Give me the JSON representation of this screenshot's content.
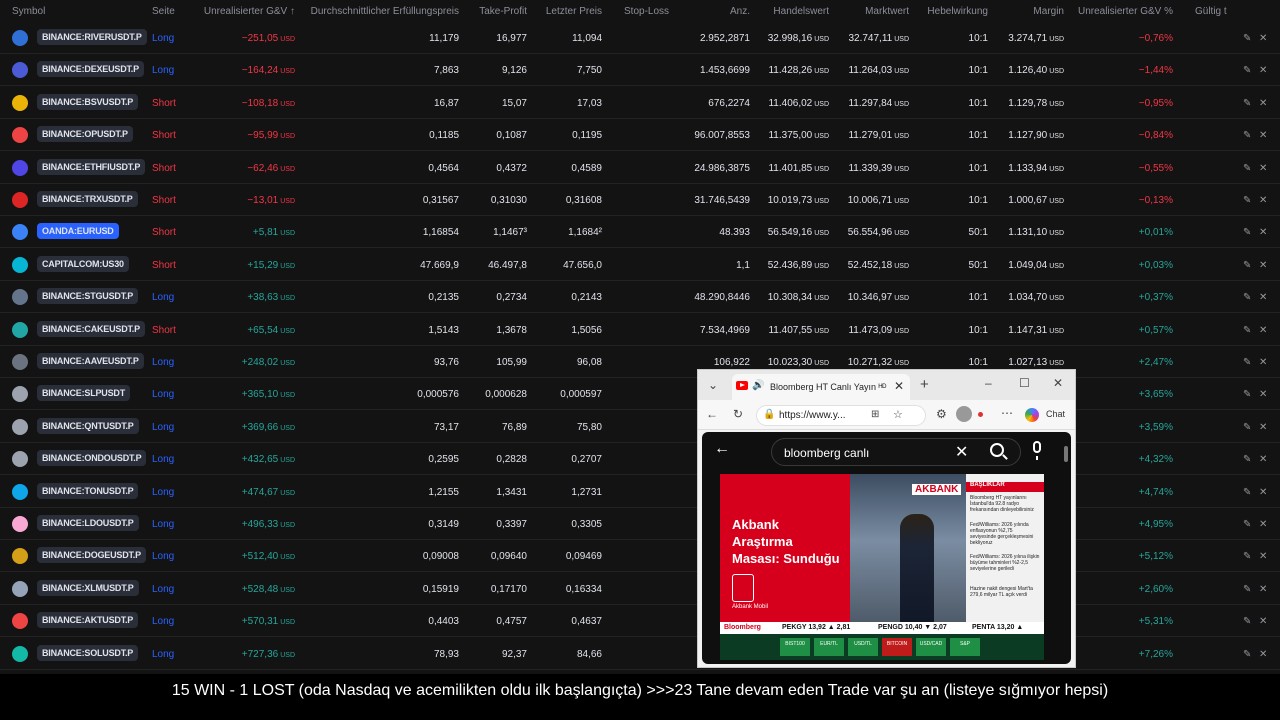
{
  "headers": {
    "symbol": "Symbol",
    "side": "Seite",
    "unrealized": "Unrealisierter G&V ↑",
    "avg_fill": "Durchschnittlicher Erfüllungspreis",
    "take_profit": "Take-Profit",
    "last_price": "Letzter Preis",
    "stop_loss": "Stop-Loss",
    "qty": "Anz.",
    "trade_value": "Handelswert",
    "market_value": "Marktwert",
    "leverage": "Hebelwirkung",
    "margin": "Margin",
    "unrealized_pct": "Unrealisierter G&V %",
    "valid": "Gültig t"
  },
  "currency": "USD",
  "rows": [
    {
      "symbol": "BINANCE:RIVERUSDT.P",
      "side": "Long",
      "pnl": "−251,05",
      "avg": "11,179",
      "tp": "16,977",
      "last": "11,094",
      "qty": "2.952,2871",
      "tv": "32.998,16",
      "mv": "32.747,11",
      "lev": "10:1",
      "margin": "3.274,71",
      "pct": "−0,76%"
    },
    {
      "symbol": "BINANCE:DEXEUSDT.P",
      "side": "Long",
      "pnl": "−164,24",
      "avg": "7,863",
      "tp": "9,126",
      "last": "7,750",
      "qty": "1.453,6699",
      "tv": "11.428,26",
      "mv": "11.264,03",
      "lev": "10:1",
      "margin": "1.126,40",
      "pct": "−1,44%"
    },
    {
      "symbol": "BINANCE:BSVUSDT.P",
      "side": "Short",
      "pnl": "−108,18",
      "avg": "16,87",
      "tp": "15,07",
      "last": "17,03",
      "qty": "676,2274",
      "tv": "11.406,02",
      "mv": "11.297,84",
      "lev": "10:1",
      "margin": "1.129,78",
      "pct": "−0,95%"
    },
    {
      "symbol": "BINANCE:OPUSDT.P",
      "side": "Short",
      "pnl": "−95,99",
      "avg": "0,1185",
      "tp": "0,1087",
      "last": "0,1195",
      "qty": "96.007,8553",
      "tv": "11.375,00",
      "mv": "11.279,01",
      "lev": "10:1",
      "margin": "1.127,90",
      "pct": "−0,84%"
    },
    {
      "symbol": "BINANCE:ETHFIUSDT.P",
      "side": "Short",
      "pnl": "−62,46",
      "avg": "0,4564",
      "tp": "0,4372",
      "last": "0,4589",
      "qty": "24.986,3875",
      "tv": "11.401,85",
      "mv": "11.339,39",
      "lev": "10:1",
      "margin": "1.133,94",
      "pct": "−0,55%"
    },
    {
      "symbol": "BINANCE:TRXUSDT.P",
      "side": "Short",
      "pnl": "−13,01",
      "avg": "0,31567",
      "tp": "0,31030",
      "last": "0,31608",
      "qty": "31.746,5439",
      "tv": "10.019,73",
      "mv": "10.006,71",
      "lev": "10:1",
      "margin": "1.000,67",
      "pct": "−0,13%"
    },
    {
      "symbol": "OANDA:EURUSD",
      "side": "Short",
      "pnl": "+5,81",
      "avg": "1,16854",
      "tp": "1,1467³",
      "last": "1,1684²",
      "qty": "48.393",
      "tv": "56.549,16",
      "mv": "56.554,96",
      "lev": "50:1",
      "margin": "1.131,10",
      "pct": "+0,01%"
    },
    {
      "symbol": "CAPITALCOM:US30",
      "side": "Short",
      "pnl": "+15,29",
      "avg": "47.669,9",
      "tp": "46.497,8",
      "last": "47.656,0",
      "qty": "1,1",
      "tv": "52.436,89",
      "mv": "52.452,18",
      "lev": "50:1",
      "margin": "1.049,04",
      "pct": "+0,03%"
    },
    {
      "symbol": "BINANCE:STGUSDT.P",
      "side": "Long",
      "pnl": "+38,63",
      "avg": "0,2135",
      "tp": "0,2734",
      "last": "0,2143",
      "qty": "48.290,8446",
      "tv": "10.308,34",
      "mv": "10.346,97",
      "lev": "10:1",
      "margin": "1.034,70",
      "pct": "+0,37%"
    },
    {
      "symbol": "BINANCE:CAKEUSDT.P",
      "side": "Short",
      "pnl": "+65,54",
      "avg": "1,5143",
      "tp": "1,3678",
      "last": "1,5056",
      "qty": "7.534,4969",
      "tv": "11.407,55",
      "mv": "11.473,09",
      "lev": "10:1",
      "margin": "1.147,31",
      "pct": "+0,57%"
    },
    {
      "symbol": "BINANCE:AAVEUSDT.P",
      "side": "Long",
      "pnl": "+248,02",
      "avg": "93,76",
      "tp": "105,99",
      "last": "96,08",
      "qty": "106,922",
      "tv": "10.023,30",
      "mv": "10.271,32",
      "lev": "10:1",
      "margin": "1.027,13",
      "pct": "+2,47%"
    },
    {
      "symbol": "BINANCE:SLPUSDT",
      "side": "Long",
      "pnl": "+365,10",
      "avg": "0,000576",
      "tp": "0,000628",
      "last": "0,000597",
      "qty": "17.",
      "tv": "",
      "mv": "",
      "lev": "",
      "margin": "",
      "pct": "+3,65%"
    },
    {
      "symbol": "BINANCE:QNTUSDT.P",
      "side": "Long",
      "pnl": "+369,66",
      "avg": "73,17",
      "tp": "76,89",
      "last": "75,80",
      "qty": "",
      "tv": "",
      "mv": "",
      "lev": "",
      "margin": "",
      "pct": "+3,59%"
    },
    {
      "symbol": "BINANCE:ONDOUSDT.P",
      "side": "Long",
      "pnl": "+432,65",
      "avg": "0,2595",
      "tp": "0,2828",
      "last": "0,2707",
      "qty": "",
      "tv": "",
      "mv": "",
      "lev": "",
      "margin": "",
      "pct": "+4,32%"
    },
    {
      "symbol": "BINANCE:TONUSDT.P",
      "side": "Long",
      "pnl": "+474,67",
      "avg": "1,2155",
      "tp": "1,3431",
      "last": "1,2731",
      "qty": "",
      "tv": "",
      "mv": "",
      "lev": "",
      "margin": "",
      "pct": "+4,74%"
    },
    {
      "symbol": "BINANCE:LDOUSDT.P",
      "side": "Long",
      "pnl": "+496,33",
      "avg": "0,3149",
      "tp": "0,3397",
      "last": "0,3305",
      "qty": "",
      "tv": "",
      "mv": "",
      "lev": "",
      "margin": "",
      "pct": "+4,95%"
    },
    {
      "symbol": "BINANCE:DOGEUSDT.P",
      "side": "Long",
      "pnl": "+512,40",
      "avg": "0,09008",
      "tp": "0,09640",
      "last": "0,09469",
      "qty": "",
      "tv": "",
      "mv": "",
      "lev": "",
      "margin": "",
      "pct": "+5,12%"
    },
    {
      "symbol": "BINANCE:XLMUSDT.P",
      "side": "Long",
      "pnl": "+528,48",
      "avg": "0,15919",
      "tp": "0,17170",
      "last": "0,16334",
      "qty": "1",
      "tv": "",
      "mv": "",
      "lev": "",
      "margin": "",
      "pct": "+2,60%"
    },
    {
      "symbol": "BINANCE:AKTUSDT.P",
      "side": "Long",
      "pnl": "+570,31",
      "avg": "0,4403",
      "tp": "0,4757",
      "last": "0,4637",
      "qty": "",
      "tv": "",
      "mv": "",
      "lev": "",
      "margin": "",
      "pct": "+5,31%"
    },
    {
      "symbol": "BINANCE:SOLUSDT.P",
      "side": "Long",
      "pnl": "+727,36",
      "avg": "78,93",
      "tp": "92,37",
      "last": "84,66",
      "qty": "",
      "tv": "",
      "mv": "",
      "lev": "",
      "margin": "",
      "pct": "+7,26%"
    }
  ],
  "logo_colors": [
    "#2f6fd6",
    "#4b5bd6",
    "#eab308",
    "#ef4444",
    "#4f46e5",
    "#dc2626",
    "#3b82f6",
    "#06b6d4",
    "#64748b",
    "#22a5a5",
    "#6b7280",
    "#9ca3af",
    "#9ca3af",
    "#9ca3af",
    "#0ea5e9",
    "#f9a8d4",
    "#d4a017",
    "#94a3b8",
    "#ef4444",
    "#14b8a6"
  ],
  "caption": "15 WIN - 1 LOST (oda Nasdaq ve acemilikten oldu ilk başlangıçta) >>>23 Tane devam eden Trade var şu an (listeye sığmıyor hepsi)",
  "browser": {
    "tab_title": "Bloomberg HT Canlı Yayın ᴴᴰ",
    "url": "https://www.y...",
    "chat_label": "Chat",
    "search_query": "bloomberg canlı",
    "video": {
      "headline": "Akbank Araştırma Masası: Sunduğu",
      "logo_text": "Akbank Mobil",
      "bank_name": "AKBANK",
      "sidebar_heading": "BAŞLIKLAR",
      "sidebar_lines": [
        "Bloomberg HT yayınlarını İstanbul'da 92.8 radyo frekansından dinleyebilirsiniz",
        "Fed/Williams: 2026 yılında enflasyonun %2,75 seviyesinde gerçekleşmesini bekliyoruz",
        "Fed/Williams: 2026 yılına ilişkin büyüme tahminleri %2-2,5 seviyelerine geriledi",
        "Hazine nakit dengesi Mart'ta 279,6 milyar TL açık verdi"
      ],
      "ticker_items": [
        "Bloomberg",
        "PEKGY 13,92 ▲ 2,81",
        "PENGD 10,40 ▼ 2,07",
        "PENTA 13,20 ▲"
      ],
      "ticker_cells": [
        "BIST100",
        "EUR/TL",
        "USD/TL",
        "BITCOIN",
        "USD/CAD",
        "S&P"
      ]
    }
  }
}
